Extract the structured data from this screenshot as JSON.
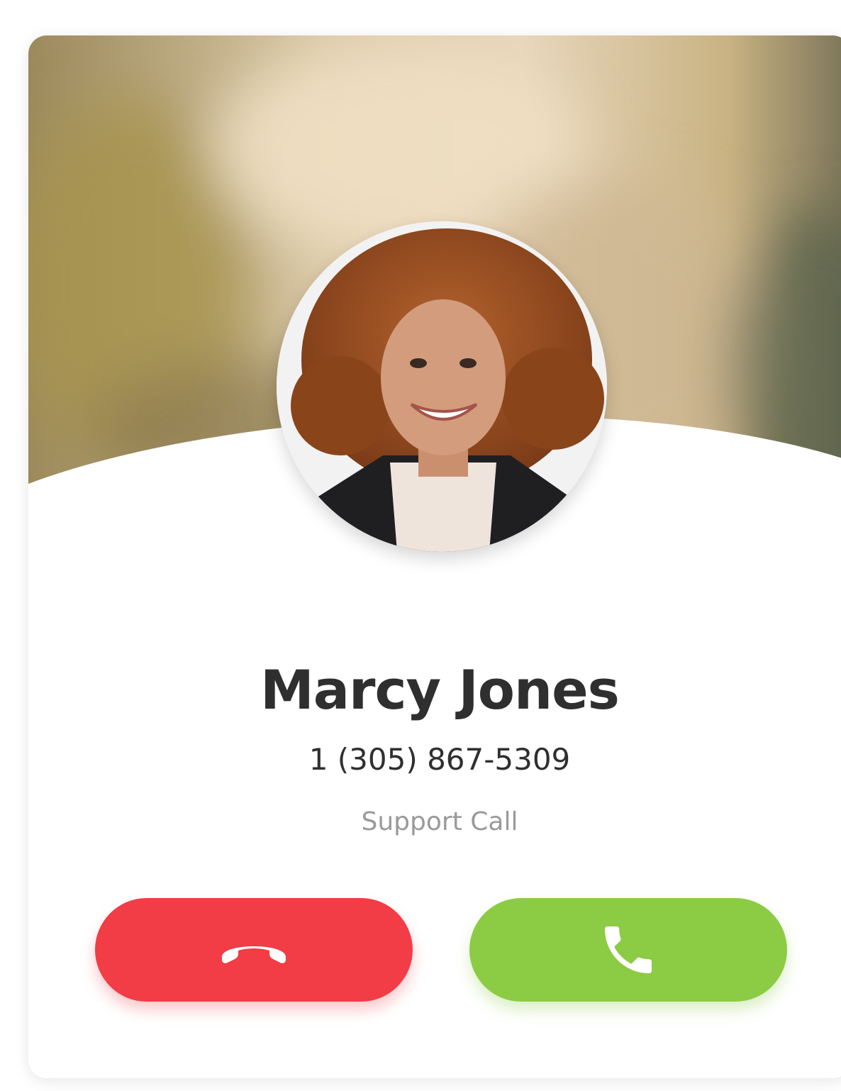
{
  "caller": {
    "name": "Marcy Jones",
    "phone": "1 (305) 867-5309",
    "call_type": "Support Call"
  },
  "actions": {
    "decline_icon": "hang-up-icon",
    "accept_icon": "phone-icon"
  },
  "colors": {
    "decline": "#f23c46",
    "accept": "#8ccb44",
    "name_text": "#2f2f2f",
    "secondary_text": "#9a9a9a"
  }
}
